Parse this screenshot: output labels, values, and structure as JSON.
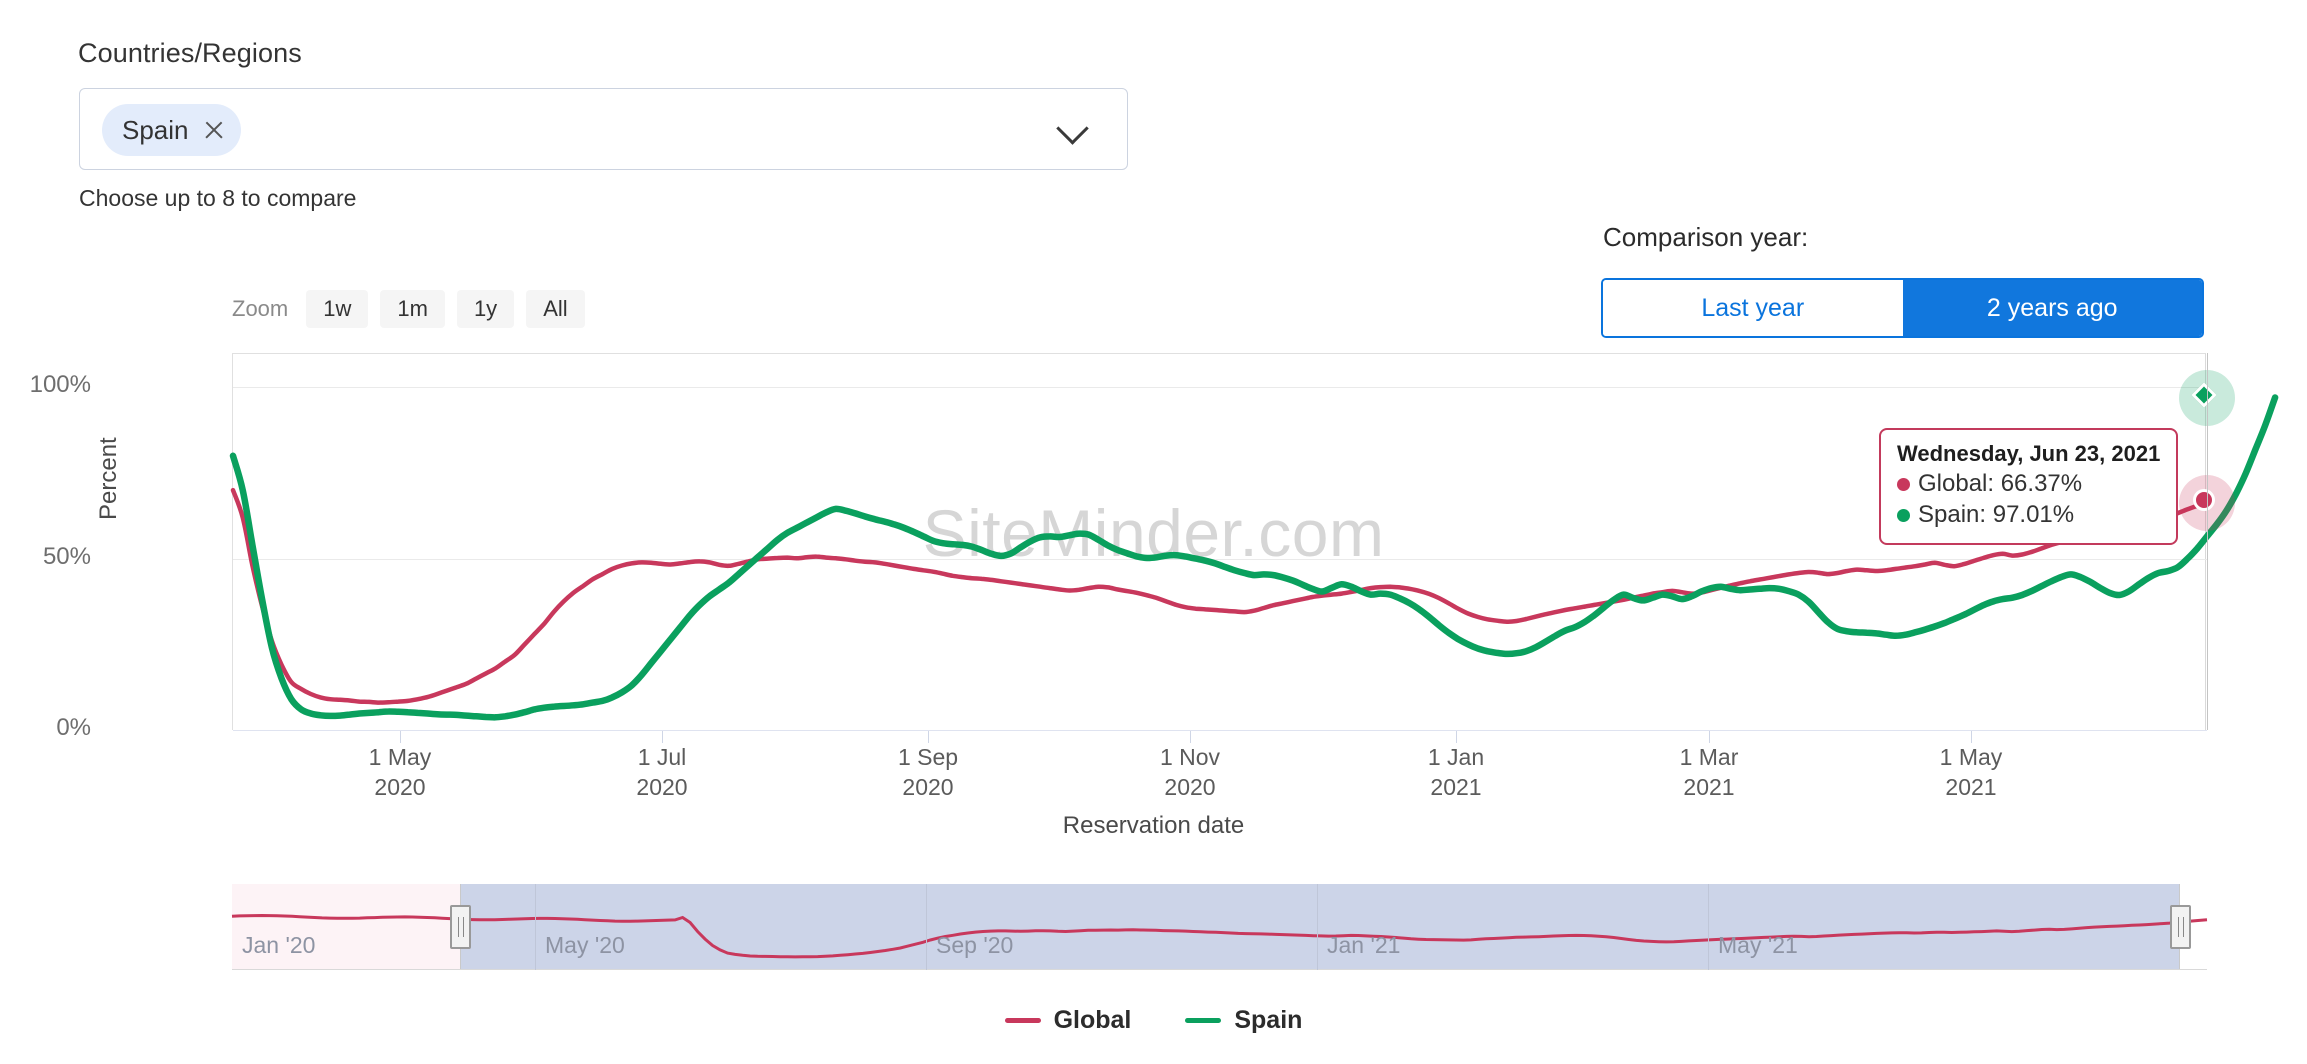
{
  "selector": {
    "label": "Countries/Regions",
    "tag": "Spain",
    "remove_icon": "close-icon",
    "dropdown_icon": "chevron-down-icon",
    "hint": "Choose up to 8 to compare"
  },
  "zoom_control": {
    "label": "Zoom",
    "options": [
      "1w",
      "1m",
      "1y",
      "All"
    ]
  },
  "comparison": {
    "label": "Comparison year:",
    "options": [
      {
        "label": "Last year",
        "active": false
      },
      {
        "label": "2 years ago",
        "active": true
      }
    ],
    "accent": "#1177dd"
  },
  "tooltip": {
    "date": "Wednesday, Jun 23, 2021",
    "rows": [
      {
        "name": "Global",
        "value": "66.37%",
        "color": "#c8385c"
      },
      {
        "name": "Spain",
        "value": "97.01%",
        "color": "#0aa05e"
      }
    ]
  },
  "watermark": "SiteMinder.com",
  "navigator": {
    "xlabels": [
      "Jan '20",
      "May '20",
      "Sep '20",
      "Jan '21",
      "May '21"
    ],
    "selection_start_label": "May '20",
    "handle_icon": "drag-handle-icon"
  },
  "legend": [
    {
      "label": "Global",
      "color": "#c8385c"
    },
    {
      "label": "Spain",
      "color": "#0aa05e"
    }
  ],
  "chart_data": {
    "type": "line",
    "title": "",
    "xlabel": "Reservation date",
    "ylabel": "Percent",
    "ylim": [
      0,
      110
    ],
    "yticks": [
      "0%",
      "50%",
      "100%"
    ],
    "ytick_values": [
      0,
      50,
      100
    ],
    "grid": true,
    "legend_position": "bottom",
    "xtick_labels": [
      {
        "day": "1 May",
        "year": "2020"
      },
      {
        "day": "1 Jul",
        "year": "2020"
      },
      {
        "day": "1 Sep",
        "year": "2020"
      },
      {
        "day": "1 Nov",
        "year": "2020"
      },
      {
        "day": "1 Jan",
        "year": "2021"
      },
      {
        "day": "1 Mar",
        "year": "2021"
      },
      {
        "day": "1 May",
        "year": "2021"
      }
    ],
    "x_range": [
      "2020-03-20",
      "2021-06-23"
    ],
    "annotations": [
      "SiteMinder.com"
    ],
    "series": [
      {
        "name": "Global",
        "color": "#c8385c",
        "end_marker": "circle",
        "end_value": 66.37,
        "values": [
          70,
          62,
          48,
          36,
          26,
          19,
          14,
          12,
          10.5,
          9.5,
          9,
          8.8,
          8.6,
          8.3,
          8.2,
          8,
          8.1,
          8.3,
          8.5,
          9,
          9.6,
          10.5,
          11.5,
          12.5,
          13.5,
          15,
          16.5,
          18,
          20,
          22,
          25,
          28,
          31,
          34.5,
          37.5,
          40,
          42,
          44,
          45.5,
          47,
          48,
          48.6,
          48.9,
          48.8,
          48.5,
          48.3,
          48.6,
          49,
          49.2,
          48.9,
          48.2,
          47.9,
          48.5,
          49.2,
          49.8,
          50,
          50.2,
          50.3,
          50.1,
          50.4,
          50.6,
          50.3,
          50.1,
          49.8,
          49.4,
          49.1,
          48.9,
          48.5,
          48,
          47.5,
          47,
          46.6,
          46.2,
          45.6,
          45,
          44.6,
          44.3,
          44.1,
          43.8,
          43.4,
          43,
          42.6,
          42.2,
          41.8,
          41.4,
          41,
          40.7,
          40.9,
          41.4,
          41.8,
          41.6,
          41,
          40.5,
          40,
          39.3,
          38.5,
          37.5,
          36.5,
          35.8,
          35.4,
          35.2,
          35,
          34.8,
          34.6,
          34.4,
          34.8,
          35.6,
          36.4,
          37,
          37.6,
          38.2,
          38.8,
          39.2,
          39.5,
          39.8,
          40.3,
          40.8,
          41.4,
          41.7,
          41.8,
          41.6,
          41.2,
          40.6,
          39.7,
          38.5,
          37,
          35.4,
          34,
          33,
          32.3,
          31.9,
          31.6,
          31.8,
          32.4,
          33.1,
          33.8,
          34.4,
          35,
          35.5,
          36,
          36.5,
          37,
          37.5,
          38,
          38.6,
          39.2,
          39.8,
          40.2,
          40.6,
          40.2,
          39.8,
          40.1,
          40.8,
          41.5,
          42.2,
          42.8,
          43.4,
          43.9,
          44.4,
          44.9,
          45.4,
          45.8,
          46.1,
          45.9,
          45.5,
          45.8,
          46.4,
          46.8,
          46.6,
          46.4,
          46.6,
          47,
          47.4,
          47.8,
          48.3,
          48.8,
          48.2,
          47.8,
          48.4,
          49.3,
          50.2,
          51,
          51.4,
          50.9,
          51.2,
          52,
          53,
          54,
          54.8,
          55.4,
          55.9,
          56.4,
          57,
          57.6,
          58.2,
          58.8,
          59.5,
          60.3,
          61.2,
          62.2,
          63.3,
          64.4,
          65.4,
          66.37
        ]
      },
      {
        "name": "Spain",
        "color": "#0aa05e",
        "end_marker": "diamond",
        "end_value": 97.01,
        "values": [
          80,
          70,
          54,
          38,
          24,
          15,
          9,
          6,
          4.8,
          4.3,
          4.1,
          4.2,
          4.5,
          4.8,
          5,
          5.2,
          5.4,
          5.3,
          5.2,
          5,
          4.8,
          4.6,
          4.5,
          4.4,
          4.2,
          4,
          3.8,
          3.7,
          4,
          4.5,
          5.2,
          6,
          6.5,
          6.8,
          7,
          7.2,
          7.5,
          8,
          8.5,
          9.5,
          11,
          13,
          16,
          19.5,
          23,
          26.5,
          30,
          33.5,
          36.5,
          39,
          41,
          43,
          45.5,
          48,
          50.5,
          53,
          55.5,
          57.5,
          59,
          60.5,
          62,
          63.5,
          64.5,
          64,
          63.2,
          62.3,
          61.5,
          60.8,
          60,
          59,
          57.8,
          56.5,
          55.2,
          54.5,
          54.2,
          54,
          53.5,
          52.5,
          51.4,
          50.8,
          51.5,
          53.3,
          55,
          56.2,
          56.5,
          56.3,
          56.8,
          57.3,
          57,
          55.5,
          53.8,
          52.5,
          51.5,
          50.6,
          50.2,
          50.4,
          50.9,
          51,
          50.6,
          50,
          49.4,
          48.6,
          47.6,
          46.6,
          45.8,
          45.2,
          45.4,
          45.2,
          44.5,
          43.6,
          42.4,
          41.2,
          40.4,
          41.5,
          42.5,
          41.8,
          40.5,
          39.5,
          39.8,
          39.5,
          38.4,
          37,
          35.2,
          33,
          30.6,
          28.4,
          26.5,
          25,
          23.8,
          23,
          22.5,
          22.2,
          22.4,
          23,
          24.2,
          25.8,
          27.5,
          29,
          30,
          31.5,
          33.5,
          35.8,
          38,
          39.5,
          38.5,
          37.8,
          38.6,
          39.5,
          39,
          38.2,
          39,
          40.4,
          41.4,
          41.8,
          41.2,
          40.8,
          41,
          41.2,
          41.4,
          41.2,
          40.5,
          39.5,
          37.5,
          34.5,
          31.5,
          29.5,
          28.8,
          28.5,
          28.4,
          28.2,
          27.8,
          27.5,
          27.8,
          28.5,
          29.3,
          30.2,
          31.2,
          32.4,
          33.6,
          35,
          36.4,
          37.5,
          38.2,
          38.6,
          39.4,
          40.6,
          42,
          43.4,
          44.6,
          45.4,
          44.6,
          43.2,
          41.5,
          40,
          39.4,
          40.5,
          42.5,
          44.4,
          45.8,
          46.4,
          47.5,
          50,
          53,
          56.5,
          60,
          64,
          69,
          75,
          82,
          89,
          97.01
        ]
      }
    ]
  }
}
